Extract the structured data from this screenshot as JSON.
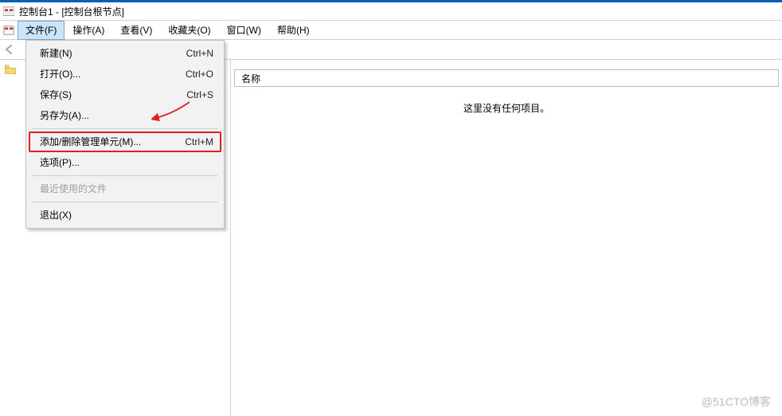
{
  "title": "控制台1 - [控制台根节点]",
  "menu": {
    "file": "文件(F)",
    "action": "操作(A)",
    "view": "查看(V)",
    "fav": "收藏夹(O)",
    "window": "窗口(W)",
    "help": "帮助(H)"
  },
  "dropdown": {
    "new": {
      "label": "新建(N)",
      "accel": "Ctrl+N"
    },
    "open": {
      "label": "打开(O)...",
      "accel": "Ctrl+O"
    },
    "save": {
      "label": "保存(S)",
      "accel": "Ctrl+S"
    },
    "saveas": {
      "label": "另存为(A)...",
      "accel": ""
    },
    "addremove": {
      "label": "添加/删除管理单元(M)...",
      "accel": "Ctrl+M"
    },
    "options": {
      "label": "选项(P)...",
      "accel": ""
    },
    "recent": {
      "label": "最近使用的文件",
      "accel": ""
    },
    "exit": {
      "label": "退出(X)",
      "accel": ""
    }
  },
  "tree_root_label": "",
  "list": {
    "column": "名称",
    "empty": "这里没有任何项目。"
  },
  "watermark": "@51CTO博客"
}
